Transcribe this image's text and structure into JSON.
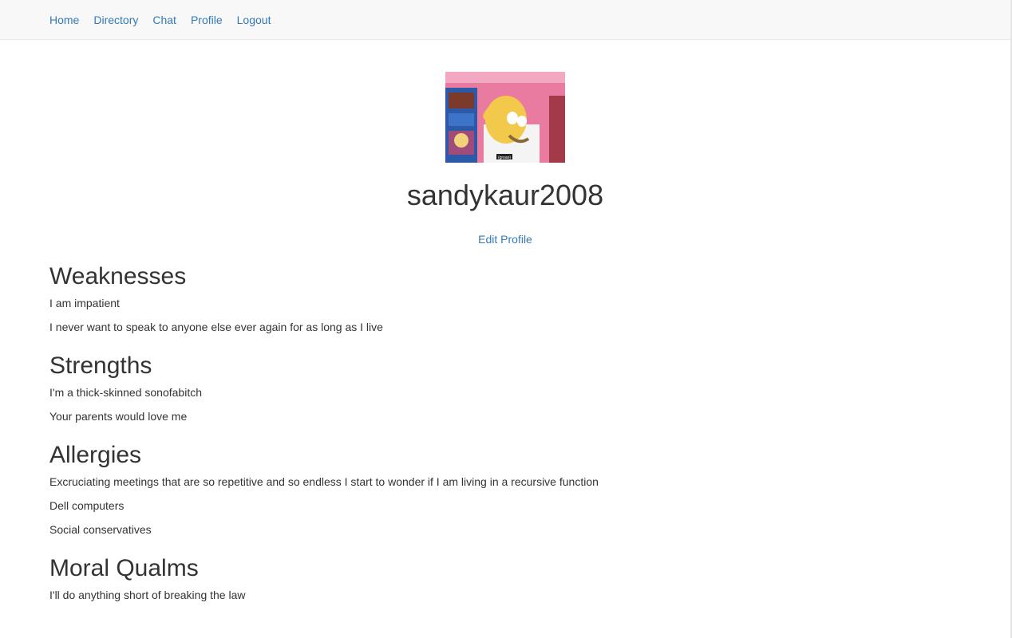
{
  "nav": {
    "items": [
      "Home",
      "Directory",
      "Chat",
      "Profile",
      "Logout"
    ]
  },
  "profile": {
    "username": "sandykaur2008",
    "edit_label": "Edit Profile",
    "avatar_caption": "(groan)"
  },
  "sections": [
    {
      "title": "Weaknesses",
      "items": [
        "I am impatient",
        "I never want to speak to anyone else ever again for as long as I live"
      ]
    },
    {
      "title": "Strengths",
      "items": [
        "I'm a thick-skinned sonofabitch",
        "Your parents would love me"
      ]
    },
    {
      "title": "Allergies",
      "items": [
        "Excruciating meetings that are so repetitive and so endless I start to wonder if I am living in a recursive function",
        "Dell computers",
        "Social conservatives"
      ]
    },
    {
      "title": "Moral Qualms",
      "items": [
        "I'll do anything short of breaking the law"
      ]
    }
  ],
  "colors": {
    "link": "#337ab7",
    "navbar_bg": "#f8f8f8",
    "text": "#333333"
  }
}
